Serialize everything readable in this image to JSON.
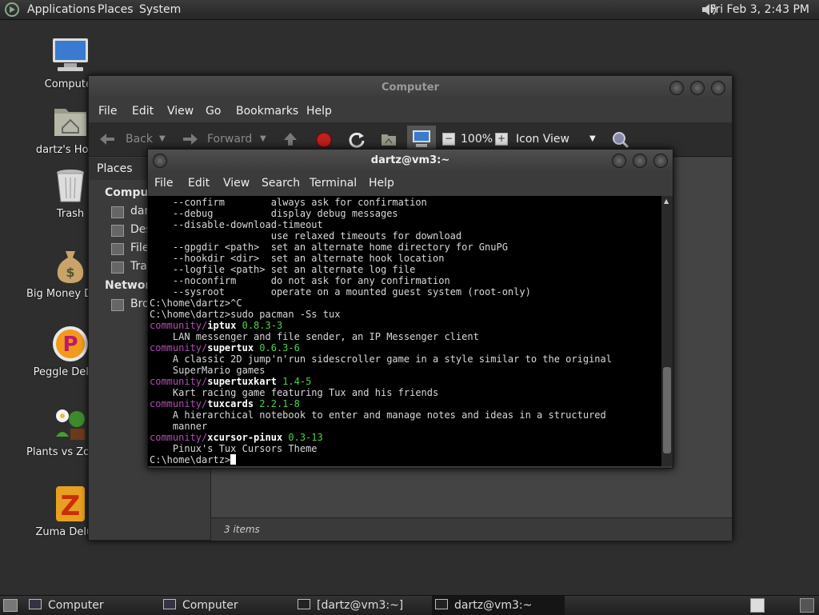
{
  "top_panel": {
    "menus": [
      "Applications",
      "Places",
      "System"
    ],
    "clock": "Fri Feb  3,  2:43 PM",
    "icons": {
      "launcher": "distro-logo-icon",
      "volume": "volume-icon"
    }
  },
  "desktop": {
    "icons": [
      {
        "label": "Computer",
        "icon": "computer-icon"
      },
      {
        "label": "dartz's Home",
        "icon": "home-folder-icon"
      },
      {
        "label": "Trash",
        "icon": "trash-icon"
      },
      {
        "label": "Big Money Deluxe",
        "icon": "money-bag-icon"
      },
      {
        "label": "Peggle Deluxe",
        "icon": "peggle-icon"
      },
      {
        "label": "Plants vs Zombies",
        "icon": "plants-icon"
      },
      {
        "label": "Zuma Deluxe",
        "icon": "zuma-icon"
      }
    ]
  },
  "file_manager": {
    "title": "Computer",
    "menu": [
      "File",
      "Edit",
      "View",
      "Go",
      "Bookmarks",
      "Help"
    ],
    "toolbar": {
      "back": "Back",
      "forward": "Forward",
      "zoom": "100%",
      "view_mode": "Icon View"
    },
    "sidebar": {
      "header": "Places",
      "sections": [
        {
          "label": "Computer",
          "items": [
            "dartz",
            "Desktop",
            "File System",
            "Trash"
          ]
        },
        {
          "label": "Network",
          "items": [
            "Browse Network"
          ]
        }
      ]
    },
    "status": "3 items"
  },
  "terminal": {
    "title": "dartz@vm3:~",
    "menu": [
      "File",
      "Edit",
      "View",
      "Search",
      "Terminal",
      "Help"
    ],
    "lines": [
      "    --confirm        always ask for confirmation",
      "    --debug          display debug messages",
      "    --disable-download-timeout",
      "                     use relaxed timeouts for download",
      "    --gpgdir <path>  set an alternate home directory for GnuPG",
      "    --hookdir <dir>  set an alternate hook location",
      "    --logfile <path> set an alternate log file",
      "    --noconfirm      do not ask for any confirmation",
      "    --sysroot        operate on a mounted guest system (root-only)",
      "C:\\home\\dartz>^C",
      "C:\\home\\dartz>sudo pacman -Ss tux"
    ],
    "results": [
      {
        "repo": "community/",
        "name": "iptux",
        "version": " 0.8.3-3",
        "desc": [
          "    LAN messenger and file sender, an IP Messenger client"
        ]
      },
      {
        "repo": "community/",
        "name": "supertux",
        "version": " 0.6.3-6",
        "desc": [
          "    A classic 2D jump'n'run sidescroller game in a style similar to the original",
          "    SuperMario games"
        ]
      },
      {
        "repo": "community/",
        "name": "supertuxkart",
        "version": " 1.4-5",
        "desc": [
          "    Kart racing game featuring Tux and his friends"
        ]
      },
      {
        "repo": "community/",
        "name": "tuxcards",
        "version": " 2.2.1-8",
        "desc": [
          "    A hierarchical notebook to enter and manage notes and ideas in a structured",
          "    manner"
        ]
      },
      {
        "repo": "community/",
        "name": "xcursor-pinux",
        "version": " 0.3-13",
        "desc": [
          "    Pinux's Tux Cursors Theme"
        ]
      }
    ],
    "prompt": "C:\\home\\dartz>"
  },
  "bottom_panel": {
    "tasks": [
      {
        "label": "Computer",
        "active": false
      },
      {
        "label": "Computer",
        "active": false
      },
      {
        "label": "[dartz@vm3:~]",
        "active": false
      },
      {
        "label": "dartz@vm3:~",
        "active": true
      }
    ]
  }
}
